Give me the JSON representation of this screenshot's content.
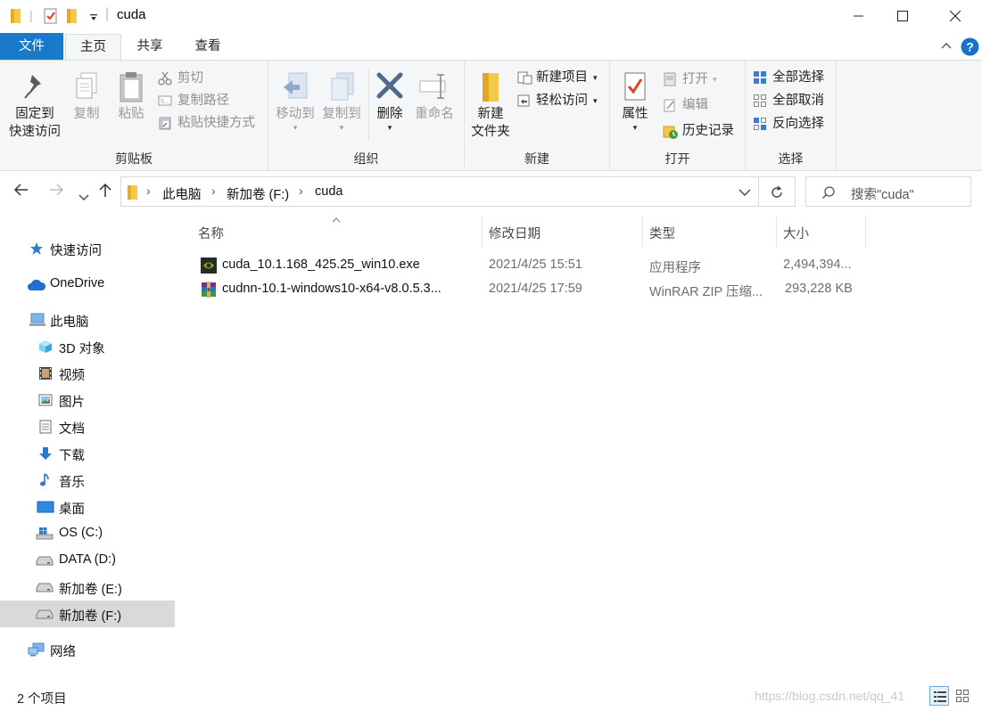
{
  "window": {
    "title": "cuda",
    "controls": [
      "minimize-icon",
      "maximize-icon",
      "close-icon"
    ]
  },
  "ribbon_tabs": {
    "file": "文件",
    "home": "主页",
    "share": "共享",
    "view": "查看"
  },
  "ribbon": {
    "clipboard": {
      "group_label": "剪贴板",
      "pin_line1": "固定到",
      "pin_line2": "快速访问",
      "copy": "复制",
      "paste": "粘贴",
      "cut": "剪切",
      "copy_path": "复制路径",
      "paste_shortcut": "粘贴快捷方式"
    },
    "organize": {
      "group_label": "组织",
      "move_to": "移动到",
      "copy_to": "复制到",
      "delete": "删除",
      "rename": "重命名"
    },
    "new": {
      "group_label": "新建",
      "new_folder_line1": "新建",
      "new_folder_line2": "文件夹",
      "new_item": "新建项目",
      "easy_access": "轻松访问"
    },
    "open": {
      "group_label": "打开",
      "properties": "属性",
      "open": "打开",
      "edit": "编辑",
      "history": "历史记录"
    },
    "select": {
      "group_label": "选择",
      "select_all": "全部选择",
      "select_none": "全部取消",
      "invert": "反向选择"
    }
  },
  "address": {
    "crumbs": [
      "此电脑",
      "新加卷 (F:)",
      "cuda"
    ],
    "search_placeholder": "搜索\"cuda\""
  },
  "nav": {
    "quick_access": "快速访问",
    "onedrive": "OneDrive",
    "this_pc": "此电脑",
    "objects3d": "3D 对象",
    "videos": "视频",
    "pictures": "图片",
    "documents": "文档",
    "downloads": "下载",
    "music": "音乐",
    "desktop": "桌面",
    "os_c": "OS (C:)",
    "data_d": "DATA (D:)",
    "vol_e": "新加卷 (E:)",
    "vol_f": "新加卷 (F:)",
    "network": "网络"
  },
  "columns": {
    "name": "名称",
    "modified": "修改日期",
    "type": "类型",
    "size": "大小"
  },
  "files": [
    {
      "name": "cuda_10.1.168_425.25_win10.exe",
      "modified": "2021/4/25 15:51",
      "type": "应用程序",
      "size": "2,494,394...",
      "icon": "nvidia-exe-icon"
    },
    {
      "name": "cudnn-10.1-windows10-x64-v8.0.5.3...",
      "modified": "2021/4/25 17:59",
      "type": "WinRAR ZIP 压缩...",
      "size": "293,228 KB",
      "icon": "winrar-zip-icon"
    }
  ],
  "status": {
    "item_count": "2 个项目",
    "watermark": "https://blog.csdn.net/qq_41"
  }
}
